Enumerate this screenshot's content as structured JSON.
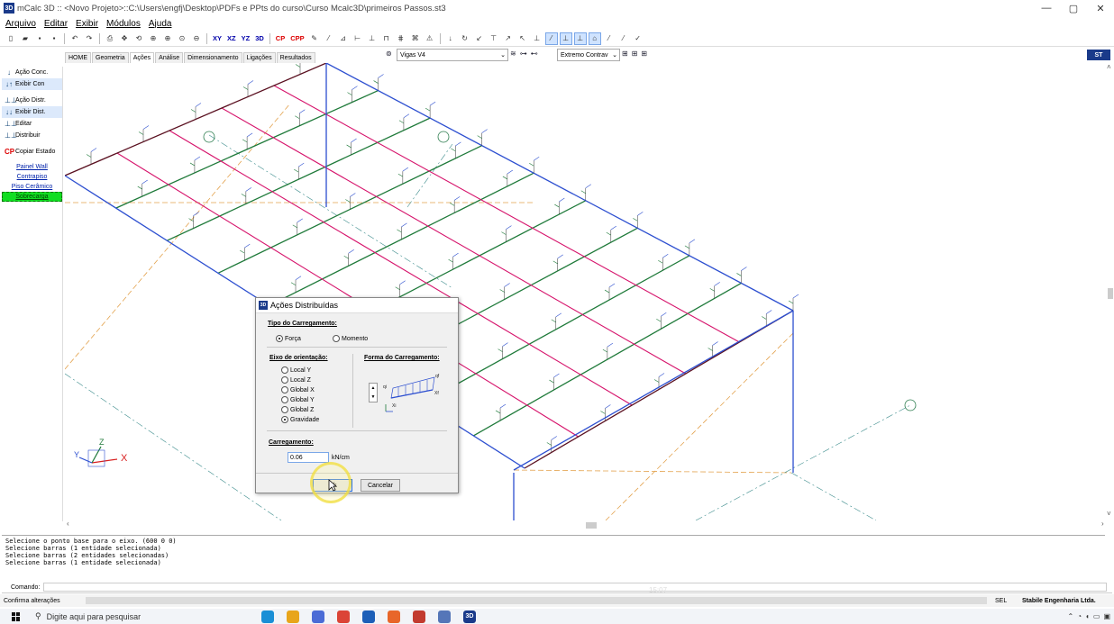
{
  "window": {
    "title": "mCalc 3D :: <Novo Projeto>::C:\\Users\\engfj\\Desktop\\PDFs e PPts do curso\\Curso Mcalc3D\\primeiros Passos.st3",
    "app_icon": "3D",
    "minimize": "—",
    "maximize": "▢",
    "close": "✕"
  },
  "menu": [
    "Arquivo",
    "Editar",
    "Exibir",
    "Módulos",
    "Ajuda"
  ],
  "toolbar": {
    "view_buttons": [
      "XY",
      "XZ",
      "YZ",
      "3D"
    ],
    "cp_buttons": [
      "CP",
      "CPP"
    ]
  },
  "tabs": [
    "HOME",
    "Geometria",
    "Ações",
    "Análise",
    "Dimensionamento",
    "Ligações",
    "Resultados"
  ],
  "active_tab": "Ações",
  "combo_profile": {
    "value": "Vigas V4"
  },
  "combo_result": {
    "value": "Extremo Contrav"
  },
  "badge_right": "ST",
  "left_panel": {
    "items": [
      {
        "label": "Ação Conc.",
        "icon": "↓"
      },
      {
        "label": "Exibir Con",
        "icon": "↓↑"
      },
      {
        "label": "Ação Distr.",
        "icon": "⊥⊥"
      },
      {
        "label": "Exibir Dist.",
        "icon": "↓↓"
      },
      {
        "label": "Editar",
        "icon": "⊥⊥"
      },
      {
        "label": "Distribuir",
        "icon": "⊥⊥"
      },
      {
        "label": "Copiar Estado",
        "icon": "CP"
      }
    ],
    "links": [
      "Painel Wall",
      "Contrapiso",
      "Piso Cerâmico",
      "Sobrecarga"
    ]
  },
  "dialog": {
    "title": "Ações Distribuídas",
    "tipo_label": "Tipo do Carregamento:",
    "tipo_options": [
      "Força",
      "Momento"
    ],
    "tipo_selected": "Força",
    "eixo_label": "Eixo de orientação:",
    "eixo_options": [
      "Local Y",
      "Local Z",
      "Global X",
      "Global Y",
      "Global Z",
      "Gravidade"
    ],
    "eixo_selected": "Gravidade",
    "forma_label": "Forma do Carregamento:",
    "carregamento_label": "Carregamento:",
    "carregamento_value": "0.06",
    "carregamento_unit": "kN/cm",
    "ok_label": "Ok",
    "cancel_label": "Cancelar",
    "diagram_labels": {
      "qi": "qi",
      "qf": "qf",
      "xi": "Xi",
      "xf": "Xf"
    }
  },
  "axis_gizmo": {
    "x": "X",
    "y": "Y",
    "z": "Z"
  },
  "console": [
    "Selecione o ponto base para o eixo. (600 0 0)",
    "Selecione barras (1 entidade selecionada)",
    "Selecione barras (2 entidades selecionadas)",
    "Selecione barras (1 entidade selecionada)"
  ],
  "command_label": "Comando:",
  "status": {
    "left": "Confirma alterações",
    "sel": "SEL",
    "company": "Stabile Engenharia Ltda.",
    "time_overlay": "15:07"
  },
  "taskbar": {
    "search_placeholder": "Digite aqui para pesquisar",
    "apps": [
      {
        "name": "edge",
        "color": "#1b8fd6"
      },
      {
        "name": "files",
        "color": "#e8a51b"
      },
      {
        "name": "store",
        "color": "#4b6bd6"
      },
      {
        "name": "chrome",
        "color": "#db4437"
      },
      {
        "name": "outlook",
        "color": "#1d5fb8"
      },
      {
        "name": "office",
        "color": "#e8662a"
      },
      {
        "name": "app7",
        "color": "#c23b2f"
      },
      {
        "name": "app8",
        "color": "#5576b8"
      },
      {
        "name": "mcalc3d",
        "color": "#1a3a8a",
        "label": "3D"
      }
    ]
  },
  "colors": {
    "beam_green": "#1f7a3a",
    "beam_pink": "#d6136b",
    "beam_blue": "#2d4fd0",
    "beam_dark": "#5a1020",
    "dash_orange": "#e3a24d",
    "dash_teal": "#3c8c8c"
  }
}
